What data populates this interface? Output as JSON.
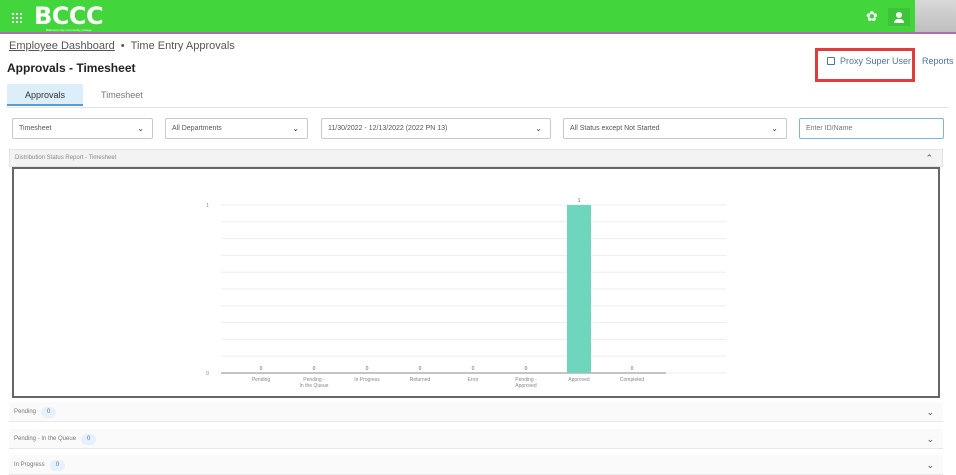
{
  "header": {
    "logo": "BCCC",
    "logo_sub": "Baltimore City Community College",
    "settings_icon": "gear-icon",
    "user_icon": "user-icon",
    "accent": "#42d63c"
  },
  "breadcrumb": {
    "home": "Employee Dashboard",
    "separator": "•",
    "current": "Time Entry Approvals"
  },
  "page_title": "Approvals - Timesheet",
  "actions": {
    "proxy_label": "Proxy Super User",
    "reports_label": "Reports"
  },
  "tabs": [
    {
      "label": "Approvals",
      "active": true
    },
    {
      "label": "Timesheet",
      "active": false
    }
  ],
  "filters": {
    "type": "Timesheet",
    "department": "All Departments",
    "period": "11/30/2022 - 12/13/2022 (2022 PN 13)",
    "status": "All Status except Not Started",
    "search_placeholder": "Enter ID/Name"
  },
  "chart_panel_title": "Distribution Status Report - Timesheet",
  "chart_data": {
    "type": "bar",
    "title": "",
    "categories": [
      "Pending",
      "Pending - In the Queue",
      "In Progress",
      "Returned",
      "Error",
      "Pending - Approved",
      "Approved",
      "Completed"
    ],
    "values": [
      0,
      0,
      0,
      0,
      0,
      0,
      1,
      0
    ],
    "ylim": [
      0,
      1
    ],
    "y_ticks": [
      "0",
      "1"
    ],
    "bar_color": "#6fd5bd",
    "grid": true
  },
  "accordions": [
    {
      "label": "Pending",
      "count": "0"
    },
    {
      "label": "Pending - In the Queue",
      "count": "0"
    },
    {
      "label": "In Progress",
      "count": "0"
    }
  ]
}
